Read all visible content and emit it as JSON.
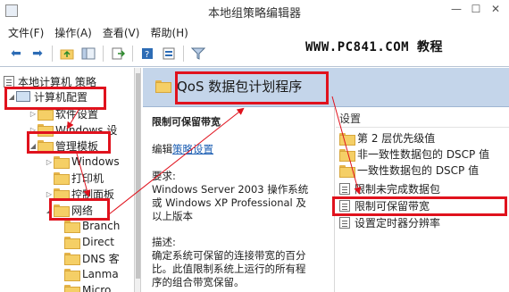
{
  "window": {
    "title": "本地组策略编辑器",
    "minimize": "—",
    "maximize": "☐",
    "close": "✕"
  },
  "menu": [
    "文件(F)",
    "操作(A)",
    "查看(V)",
    "帮助(H)"
  ],
  "watermark": "WWW.PC841.COM 教程",
  "tree": {
    "root": "本地计算机 策略",
    "computer_config": "计算机配置",
    "software_settings": "软件设置",
    "windows_settings": "Windows 设",
    "admin_templates": "管理模板",
    "windows_components": "Windows",
    "printers": "打印机",
    "control_panel": "控制面板",
    "network": "网络",
    "branch": "Branch",
    "direct": "Direct",
    "dns": "DNS 客",
    "lanman": "Lanma",
    "micro": "Micro"
  },
  "details": {
    "header_title": "QoS 数据包计划程序",
    "policy_title": "限制可保留带宽",
    "edit_prefix": "编辑",
    "edit_link": "策略设置",
    "requirements_label": "要求:",
    "requirements": [
      "Windows Server 2003 操作系统",
      "或 Windows XP Professional 及",
      "以上版本"
    ],
    "description_label": "描述:",
    "description": [
      "确定系统可保留的连接带宽的百分",
      "比。此值限制系统上运行的所有程",
      "序的组合带宽保留。"
    ]
  },
  "list": {
    "header": "设置",
    "items": [
      {
        "label": "第 2 层优先级值",
        "icon": "folder-icon"
      },
      {
        "label": "非一致性数据包的 DSCP 值",
        "icon": "folder-icon"
      },
      {
        "label": "一致性数据包的 DSCP 值",
        "icon": "folder-icon"
      },
      {
        "label": "限制未完成数据包",
        "icon": "policy-icon"
      },
      {
        "label": "限制可保留带宽",
        "icon": "policy-icon"
      },
      {
        "label": "设置定时器分辨率",
        "icon": "policy-icon"
      }
    ]
  },
  "colors": {
    "highlight_red": "#e0121d",
    "header_blue": "#c4d5ea",
    "link_blue": "#1d5fb3"
  }
}
